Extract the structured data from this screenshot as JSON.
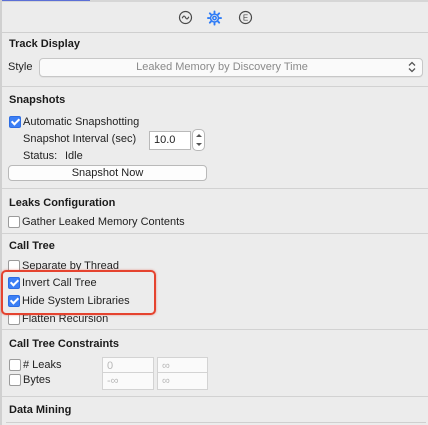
{
  "inspector_tabs": [
    {
      "name": "record-settings",
      "symbol": "~",
      "active": false
    },
    {
      "name": "display-settings",
      "symbol": "gear",
      "active": true
    },
    {
      "name": "extended-detail",
      "symbol": "E",
      "active": false
    }
  ],
  "colors": {
    "accent": "#3c7ff5",
    "highlight": "#e5432f"
  },
  "track_display": {
    "title": "Track Display",
    "style_label": "Style",
    "style_value": "Leaked Memory by Discovery Time"
  },
  "snapshots": {
    "title": "Snapshots",
    "automatic_label": "Automatic Snapshotting",
    "automatic_checked": true,
    "interval_label": "Snapshot Interval (sec)",
    "interval_value": "10.0",
    "status_label": "Status:",
    "status_value": "Idle",
    "snapshot_now_label": "Snapshot Now"
  },
  "leaks_configuration": {
    "title": "Leaks Configuration",
    "gather_label": "Gather Leaked Memory Contents",
    "gather_checked": false
  },
  "call_tree": {
    "title": "Call Tree",
    "options": [
      {
        "label": "Separate by Thread",
        "checked": false
      },
      {
        "label": "Invert Call Tree",
        "checked": true
      },
      {
        "label": "Hide System Libraries",
        "checked": true
      },
      {
        "label": "Flatten Recursion",
        "checked": false
      }
    ]
  },
  "call_tree_constraints": {
    "title": "Call Tree Constraints",
    "rows": [
      {
        "label": "# Leaks",
        "checked": false,
        "min": "0",
        "max": "∞"
      },
      {
        "label": "Bytes",
        "checked": false,
        "min": "-∞",
        "max": "∞"
      }
    ]
  },
  "data_mining": {
    "title": "Data Mining"
  }
}
